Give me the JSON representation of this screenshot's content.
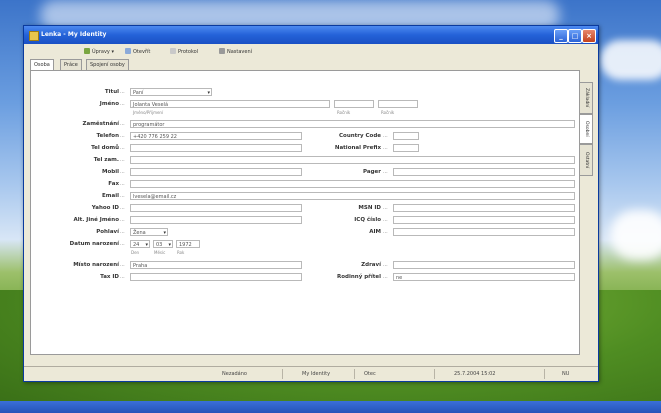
{
  "window": {
    "title": "Lenka - My Identity",
    "buttons": [
      "_",
      "□",
      "×"
    ]
  },
  "toolbar": {
    "items": [
      "Úpravy ▾",
      "Otevřít",
      "Protokol",
      "Nastavení"
    ]
  },
  "tabs": [
    "Osoba",
    "Práce",
    "Spojení osoby"
  ],
  "vtabs": [
    "Základní",
    "Osobní",
    "Ostatní"
  ],
  "form": {
    "titul": {
      "label": "Titul",
      "value": "Paní"
    },
    "jmeno": {
      "label": "Jméno",
      "value": "Jolanta Veselá",
      "sub": [
        "Jméno/Příjmení",
        "Ročník",
        "Ročník"
      ]
    },
    "zamestnani": {
      "label": "Zaměstnání",
      "value": "programátor"
    },
    "telefon": {
      "label": "Telefon",
      "value": "+420 776 259 22"
    },
    "country_code": {
      "label": "Country Code",
      "value": ""
    },
    "tel_domu": {
      "label": "Tel domů",
      "value": ""
    },
    "national_prefix": {
      "label": "National Prefix",
      "value": ""
    },
    "tel_zam": {
      "label": "Tel zam.",
      "value": ""
    },
    "mobil": {
      "label": "Mobil",
      "value": ""
    },
    "pager": {
      "label": "Pager",
      "value": ""
    },
    "fax": {
      "label": "Fax",
      "value": ""
    },
    "email": {
      "label": "Email",
      "value": "lvesela@email.cz"
    },
    "yahoo_id": {
      "label": "Yahoo ID",
      "value": ""
    },
    "msn_id": {
      "label": "MSN ID",
      "value": ""
    },
    "alt_jmeno": {
      "label": "Alt. Jiné Jméno",
      "value": ""
    },
    "icq": {
      "label": "ICQ číslo",
      "value": ""
    },
    "pohlavi": {
      "label": "Pohlaví",
      "value": "Žena"
    },
    "aim": {
      "label": "AIM",
      "value": ""
    },
    "datum_narozeni": {
      "label": "Datum narození",
      "day": "24",
      "month": "03",
      "year": "1972",
      "sub": [
        "Den",
        "Měsíc",
        "Rok"
      ]
    },
    "misto_narozeni": {
      "label": "Místo narození",
      "value": "Praha"
    },
    "zdravi": {
      "label": "Zdraví",
      "value": ""
    },
    "tax_id": {
      "label": "Tax ID",
      "value": ""
    },
    "rodinny": {
      "label": "Rodinný přítel",
      "value": "ne"
    }
  },
  "status": [
    "Nezadáno",
    "My Identity",
    "Otec",
    "25.7.2004 15:02",
    "NU"
  ]
}
